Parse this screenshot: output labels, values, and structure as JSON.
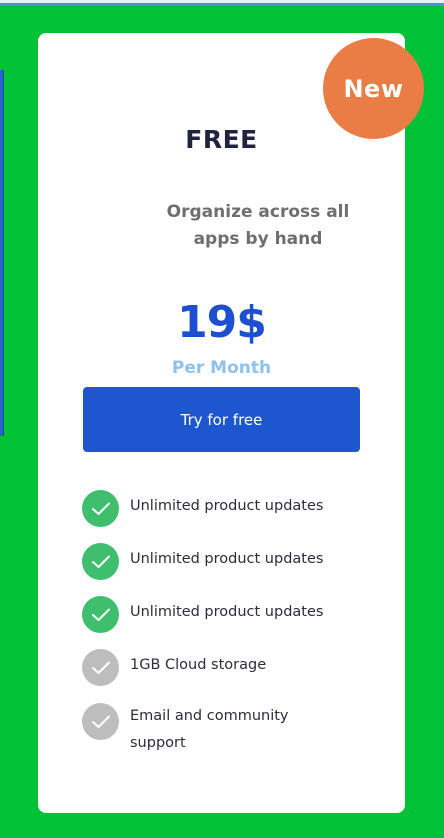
{
  "badge": {
    "label": "New",
    "color": "#ea7c45"
  },
  "plan": {
    "title": "FREE",
    "tagline": "Organize across all apps by hand",
    "price": "19$",
    "period": "Per Month"
  },
  "cta": {
    "label": "Try for free"
  },
  "features": [
    {
      "label": "Unlimited product updates",
      "included": true,
      "icon": "check-icon"
    },
    {
      "label": "Unlimited product updates",
      "included": true,
      "icon": "check-icon"
    },
    {
      "label": "Unlimited product updates",
      "included": true,
      "icon": "check-icon"
    },
    {
      "label": "1GB  Cloud storage",
      "included": false,
      "icon": "check-icon"
    },
    {
      "label": "Email and community support",
      "included": false,
      "icon": "check-icon"
    }
  ],
  "colors": {
    "background": "#00c237",
    "accent": "#1e56d0",
    "included": "#3fbf6d",
    "excluded": "#bdbdbd"
  }
}
